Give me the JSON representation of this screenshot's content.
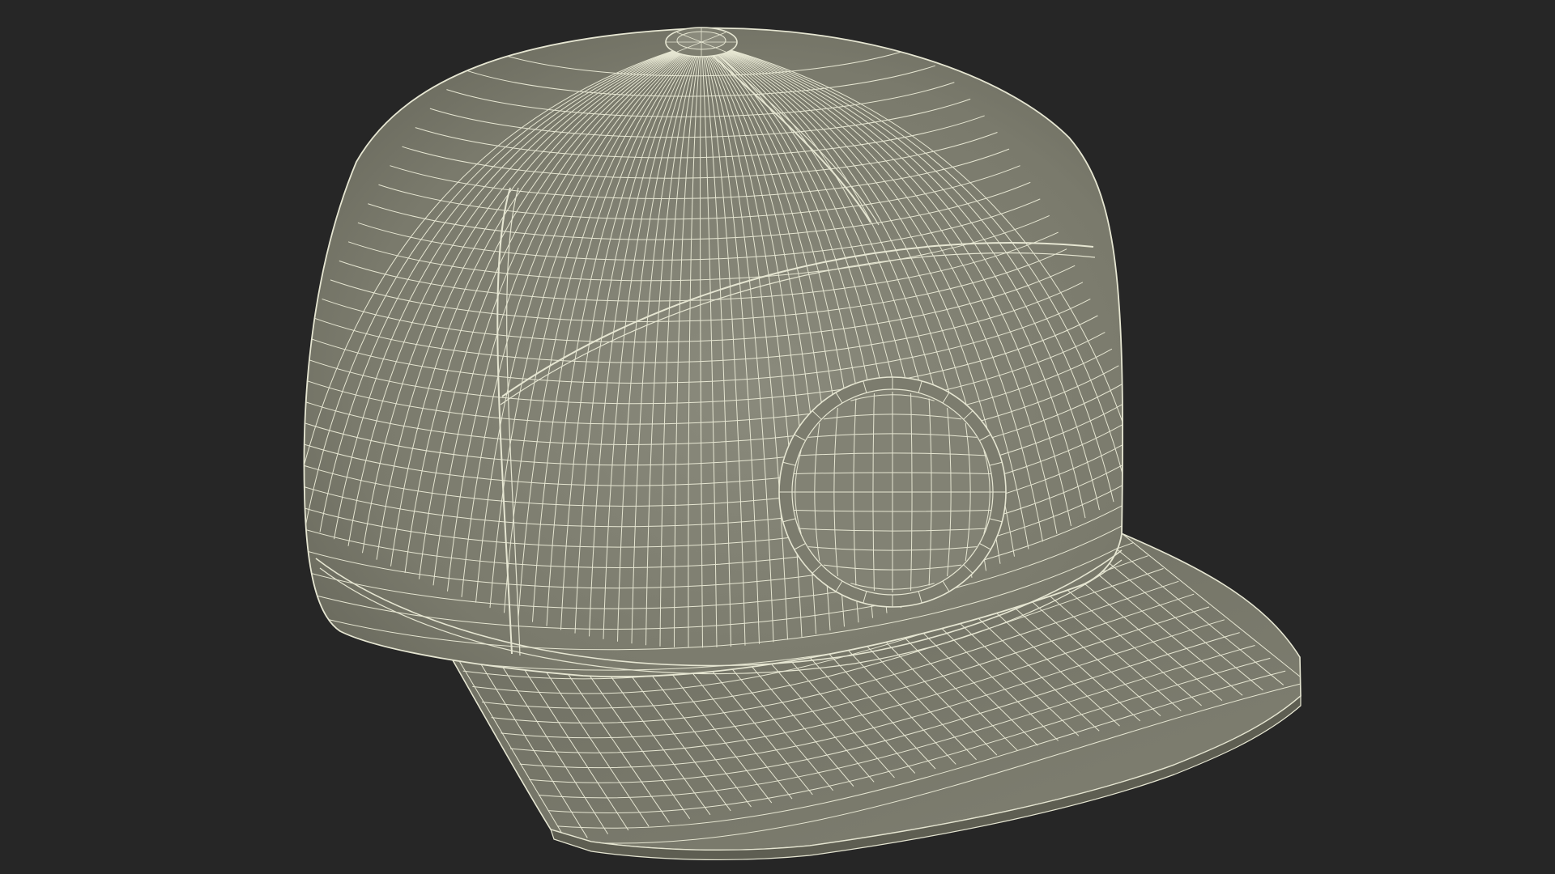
{
  "scene": {
    "subject": "baseball-cap-wireframe",
    "background_color": "#262626",
    "surface_color": "#7a7a6c",
    "surface_shadow_color": "#5e5e52",
    "surface_highlight_color": "#8a8a7c",
    "wire_color": "#e6e6d2"
  }
}
